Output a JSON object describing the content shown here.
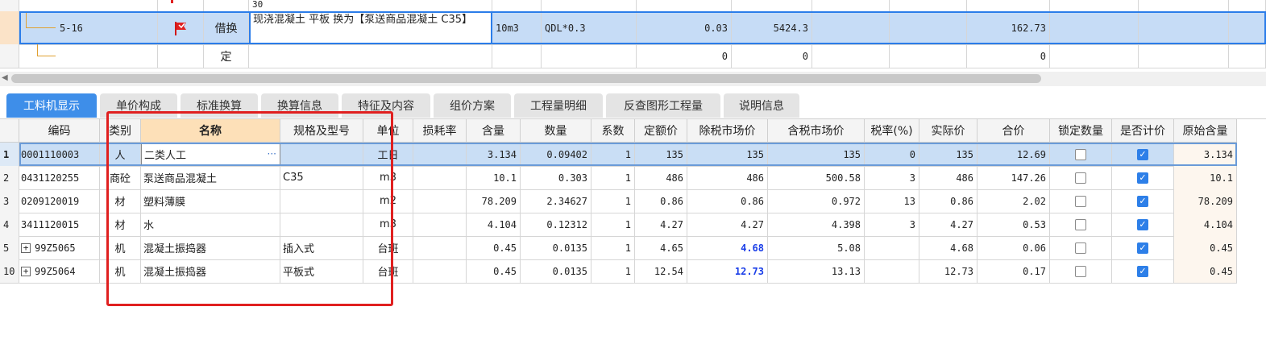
{
  "top_grid": {
    "partial_row": {
      "qty": "30"
    },
    "selected_row": {
      "code": "5-16",
      "type": "借换",
      "name": "现浇混凝土 平板  换为【泵送商品混凝土 C35】",
      "unit": "10m3",
      "expr": "QDL*0.3",
      "qty": "0.03",
      "price": "5424.3",
      "total": "162.73"
    },
    "empty_row": {
      "type": "定",
      "qty": "0",
      "price": "0",
      "total": "0"
    }
  },
  "tabs": [
    {
      "label": "工料机显示",
      "active": true
    },
    {
      "label": "单价构成"
    },
    {
      "label": "标准换算"
    },
    {
      "label": "换算信息"
    },
    {
      "label": "特征及内容"
    },
    {
      "label": "组价方案"
    },
    {
      "label": "工程量明细"
    },
    {
      "label": "反查图形工程量"
    },
    {
      "label": "说明信息"
    }
  ],
  "columns": [
    "编码",
    "类别",
    "名称",
    "规格及型号",
    "单位",
    "损耗率",
    "含量",
    "数量",
    "系数",
    "定额价",
    "除税市场价",
    "含税市场价",
    "税率(%)",
    "实际价",
    "合价",
    "锁定数量",
    "是否计价",
    "原始含量"
  ],
  "rows": [
    {
      "no": "1",
      "code": "0001110003",
      "cat": "人",
      "name": "二类人工",
      "spec": "",
      "unit": "工日",
      "loss": "",
      "content": "3.134",
      "qty": "0.09402",
      "coef": "1",
      "quota": "135",
      "ex_tax": "135",
      "inc_tax": "135",
      "tax": "0",
      "actual": "135",
      "total": "12.69",
      "locked": false,
      "priced": true,
      "orig": "3.134",
      "expand": false
    },
    {
      "no": "2",
      "code": "0431120255",
      "cat": "商砼",
      "name": "泵送商品混凝土",
      "spec": "C35",
      "unit": "m3",
      "loss": "",
      "content": "10.1",
      "qty": "0.303",
      "coef": "1",
      "quota": "486",
      "ex_tax": "486",
      "inc_tax": "500.58",
      "tax": "3",
      "actual": "486",
      "total": "147.26",
      "locked": false,
      "priced": true,
      "orig": "10.1",
      "expand": false
    },
    {
      "no": "3",
      "code": "0209120019",
      "cat": "材",
      "name": "塑料薄膜",
      "spec": "",
      "unit": "m2",
      "loss": "",
      "content": "78.209",
      "qty": "2.34627",
      "coef": "1",
      "quota": "0.86",
      "ex_tax": "0.86",
      "inc_tax": "0.972",
      "tax": "13",
      "actual": "0.86",
      "total": "2.02",
      "locked": false,
      "priced": true,
      "orig": "78.209",
      "expand": false
    },
    {
      "no": "4",
      "code": "3411120015",
      "cat": "材",
      "name": "水",
      "spec": "",
      "unit": "m3",
      "loss": "",
      "content": "4.104",
      "qty": "0.12312",
      "coef": "1",
      "quota": "4.27",
      "ex_tax": "4.27",
      "inc_tax": "4.398",
      "tax": "3",
      "actual": "4.27",
      "total": "0.53",
      "locked": false,
      "priced": true,
      "orig": "4.104",
      "expand": false
    },
    {
      "no": "5",
      "code": "99Z5065",
      "cat": "机",
      "name": "混凝土振捣器",
      "spec": "插入式",
      "unit": "台班",
      "loss": "",
      "content": "0.45",
      "qty": "0.0135",
      "coef": "1",
      "quota": "4.65",
      "ex_tax": "4.68",
      "inc_tax": "5.08",
      "tax": "",
      "actual": "4.68",
      "total": "0.06",
      "locked": false,
      "priced": true,
      "orig": "0.45",
      "expand": true,
      "blue": true
    },
    {
      "no": "10",
      "code": "99Z5064",
      "cat": "机",
      "name": "混凝土振捣器",
      "spec": "平板式",
      "unit": "台班",
      "loss": "",
      "content": "0.45",
      "qty": "0.0135",
      "coef": "1",
      "quota": "12.54",
      "ex_tax": "12.73",
      "inc_tax": "13.13",
      "tax": "",
      "actual": "12.73",
      "total": "0.17",
      "locked": false,
      "priced": true,
      "orig": "0.45",
      "expand": true,
      "blue": true
    }
  ],
  "colors": {
    "accent": "#3e8ee9",
    "selection": "#c9def5",
    "highlight_box": "#e02020",
    "name_header": "#fde0b8",
    "blue_value": "#1a3ee8"
  },
  "icons": {
    "flag": "red-flag-icon",
    "ellipsis": "ellipsis-icon",
    "checkbox": "checkbox-icon",
    "expand": "plus-square-icon"
  }
}
